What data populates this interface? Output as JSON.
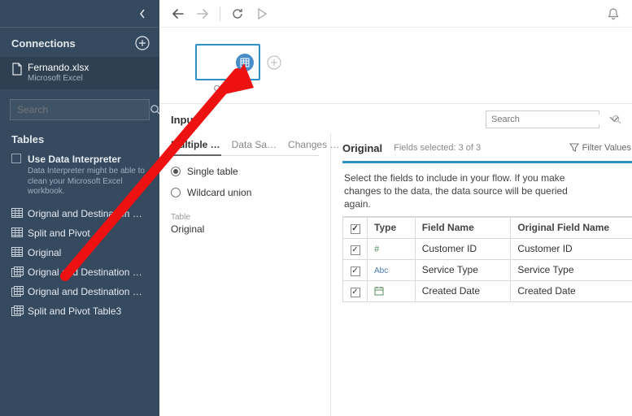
{
  "sidebar": {
    "connections_label": "Connections",
    "connection": {
      "name": "Fernando.xlsx",
      "subtype": "Microsoft Excel"
    },
    "search_placeholder": "Search",
    "tables_label": "Tables",
    "interpreter": {
      "title": "Use Data Interpreter",
      "description": "Data Interpreter might be able to clean your Microsoft Excel workbook."
    },
    "tables": [
      {
        "icon": "sheet",
        "label": "Orignal and Destination …"
      },
      {
        "icon": "sheet",
        "label": "Split and Pivot"
      },
      {
        "icon": "sheet",
        "label": "Original"
      },
      {
        "icon": "multi",
        "label": "Orignal and Destination …"
      },
      {
        "icon": "multi",
        "label": "Orignal and Destination …"
      },
      {
        "icon": "multi",
        "label": "Split and Pivot Table3"
      }
    ]
  },
  "canvas": {
    "node_label": "Original"
  },
  "config": {
    "header": "Input",
    "search_placeholder": "Search",
    "tabs": [
      "Multiple …",
      "Data Sa…",
      "Changes …"
    ],
    "active_tab": 0,
    "radio": {
      "single": "Single table",
      "wildcard": "Wildcard union",
      "selected": "single"
    },
    "table_label": "Table",
    "table_name": "Original"
  },
  "fields_panel": {
    "title": "Original",
    "selection": "Fields selected: 3 of 3",
    "filter_label": "Filter Values…",
    "message": "Select the fields to include in your flow. If you make changes to the data, the data source will be queried again.",
    "columns": {
      "type": "Type",
      "field": "Field Name",
      "orig": "Original Field Name"
    },
    "rows": [
      {
        "checked": true,
        "type": "number",
        "field": "Customer ID",
        "orig": "Customer ID"
      },
      {
        "checked": true,
        "type": "string",
        "field": "Service Type",
        "orig": "Service Type"
      },
      {
        "checked": true,
        "type": "date",
        "field": "Created Date",
        "orig": "Created Date"
      }
    ],
    "header_checked": true
  }
}
